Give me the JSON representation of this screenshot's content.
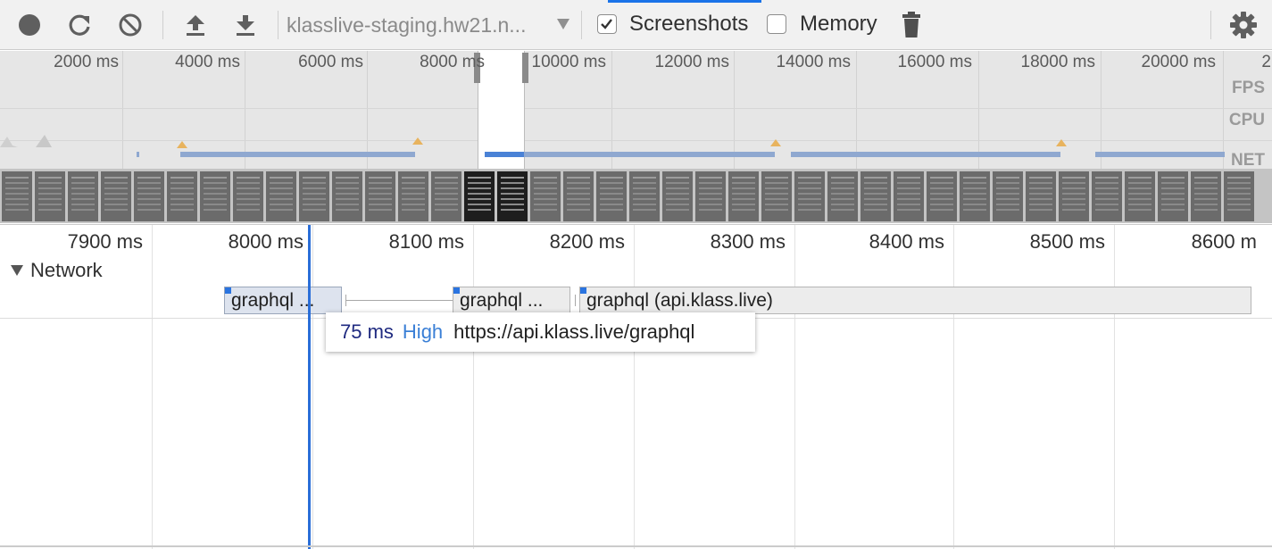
{
  "toolbar": {
    "record_icon": "record-icon",
    "reload_icon": "reload-icon",
    "clear_icon": "clear-icon",
    "upload_icon": "upload-icon",
    "download_icon": "download-icon",
    "profile_select_value": "klasslive-staging.hw21.n...",
    "screenshots_label": "Screenshots",
    "screenshots_checked": true,
    "memory_label": "Memory",
    "memory_checked": false,
    "trash_icon": "trash-icon",
    "settings_icon": "gear-icon",
    "accent_color": "#1a73e8"
  },
  "overview": {
    "ticks": [
      "2000 ms",
      "4000 ms",
      "6000 ms",
      "8000 ms",
      "10000 ms",
      "12000 ms",
      "14000 ms",
      "16000 ms",
      "18000 ms",
      "20000 ms",
      "2"
    ],
    "lane_labels": {
      "fps": "FPS",
      "cpu": "CPU",
      "net": "NET"
    },
    "net_color": "#8fa8d0",
    "cpu_color": "#e8b35e"
  },
  "detail": {
    "ticks": [
      "7900 ms",
      "8000 ms",
      "8100 ms",
      "8200 ms",
      "8300 ms",
      "8400 ms",
      "8500 ms",
      "8600 m"
    ],
    "track_title": "Network",
    "requests": [
      {
        "label": "graphql ..."
      },
      {
        "label": "graphql ..."
      },
      {
        "label": "graphql (api.klass.live)"
      }
    ],
    "tooltip": {
      "duration": "75 ms",
      "priority": "High",
      "url": "https://api.klass.live/graphql"
    },
    "cursor_color": "#2a6ed8"
  }
}
